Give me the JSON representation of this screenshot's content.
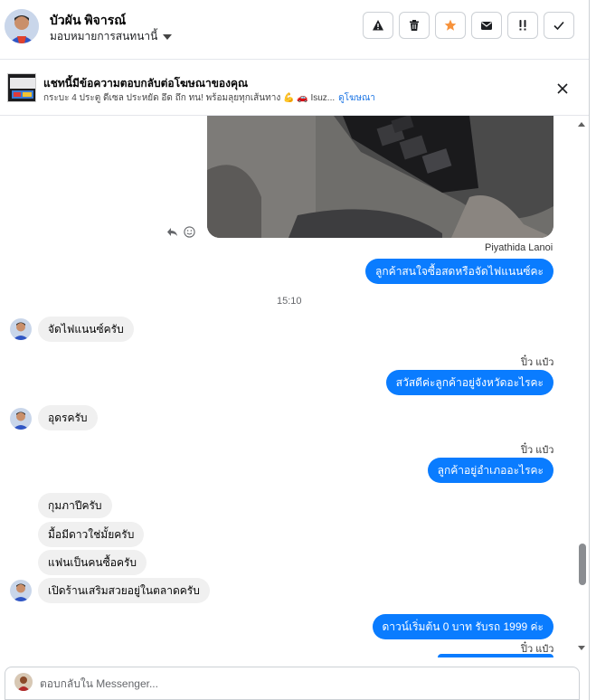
{
  "header": {
    "name": "บัวผัน พิจารณ์",
    "assign_label": "มอบหมายการสนทนานี้",
    "actions": [
      {
        "name": "report-button",
        "icon": "warning-icon"
      },
      {
        "name": "delete-button",
        "icon": "trash-icon"
      },
      {
        "name": "star-button",
        "icon": "star-icon",
        "color": "#f7923b"
      },
      {
        "name": "mark-unread-button",
        "icon": "envelope-icon"
      },
      {
        "name": "follow-up-button",
        "icon": "exclamation-icon"
      },
      {
        "name": "mark-done-button",
        "icon": "check-icon"
      }
    ]
  },
  "banner": {
    "title": "แชทนี้มีข้อความตอบกลับต่อโฆษณาของคุณ",
    "subtitle": "กระบะ 4 ประตู ดีเซล ประหยัด อึด ถึก ทน! พร้อมลุยทุกเส้นทาง 💪 🚗 Isuz...",
    "link": "ดูโฆษณา"
  },
  "chat": {
    "sender": "Piyathida Lanoi",
    "timestamp": "15:10",
    "sender2": "ปิ๋ว แป๋ว",
    "messages": [
      {
        "dir": "out",
        "text": "ลูกค้าสนใจซื้อสดหรือจัดไฟแนนซ์คะ"
      },
      {
        "dir": "in",
        "text": "จัดไฟแนนซ์ครับ"
      },
      {
        "dir": "out",
        "text": "สวัสดีค่ะลูกค้าอยู่จังหวัดอะไรคะ"
      },
      {
        "dir": "in",
        "text": "อุดรครับ"
      },
      {
        "dir": "out",
        "text": "ลูกค้าอยู่อำเภออะไรคะ"
      },
      {
        "dir": "in",
        "text": "กุมภาปีครับ"
      },
      {
        "dir": "in",
        "text": "มื้อมีดาวใช่มั้ยครับ"
      },
      {
        "dir": "in",
        "text": "แฟนเป็นคนซื้อครับ"
      },
      {
        "dir": "in",
        "text": "เปิดร้านเสริมสวยอยู่ในตลาดครับ"
      },
      {
        "dir": "out",
        "text": "ดาวน์เริ่มต้น 0 บาท รับรถ 1999 ค่ะ"
      }
    ]
  },
  "composer": {
    "placeholder": "ตอบกลับใน Messenger..."
  },
  "colors": {
    "outgoing_bubble": "#0a7cff",
    "incoming_bubble": "#f0f0f0",
    "link": "#1b74e4",
    "star": "#f7923b"
  }
}
